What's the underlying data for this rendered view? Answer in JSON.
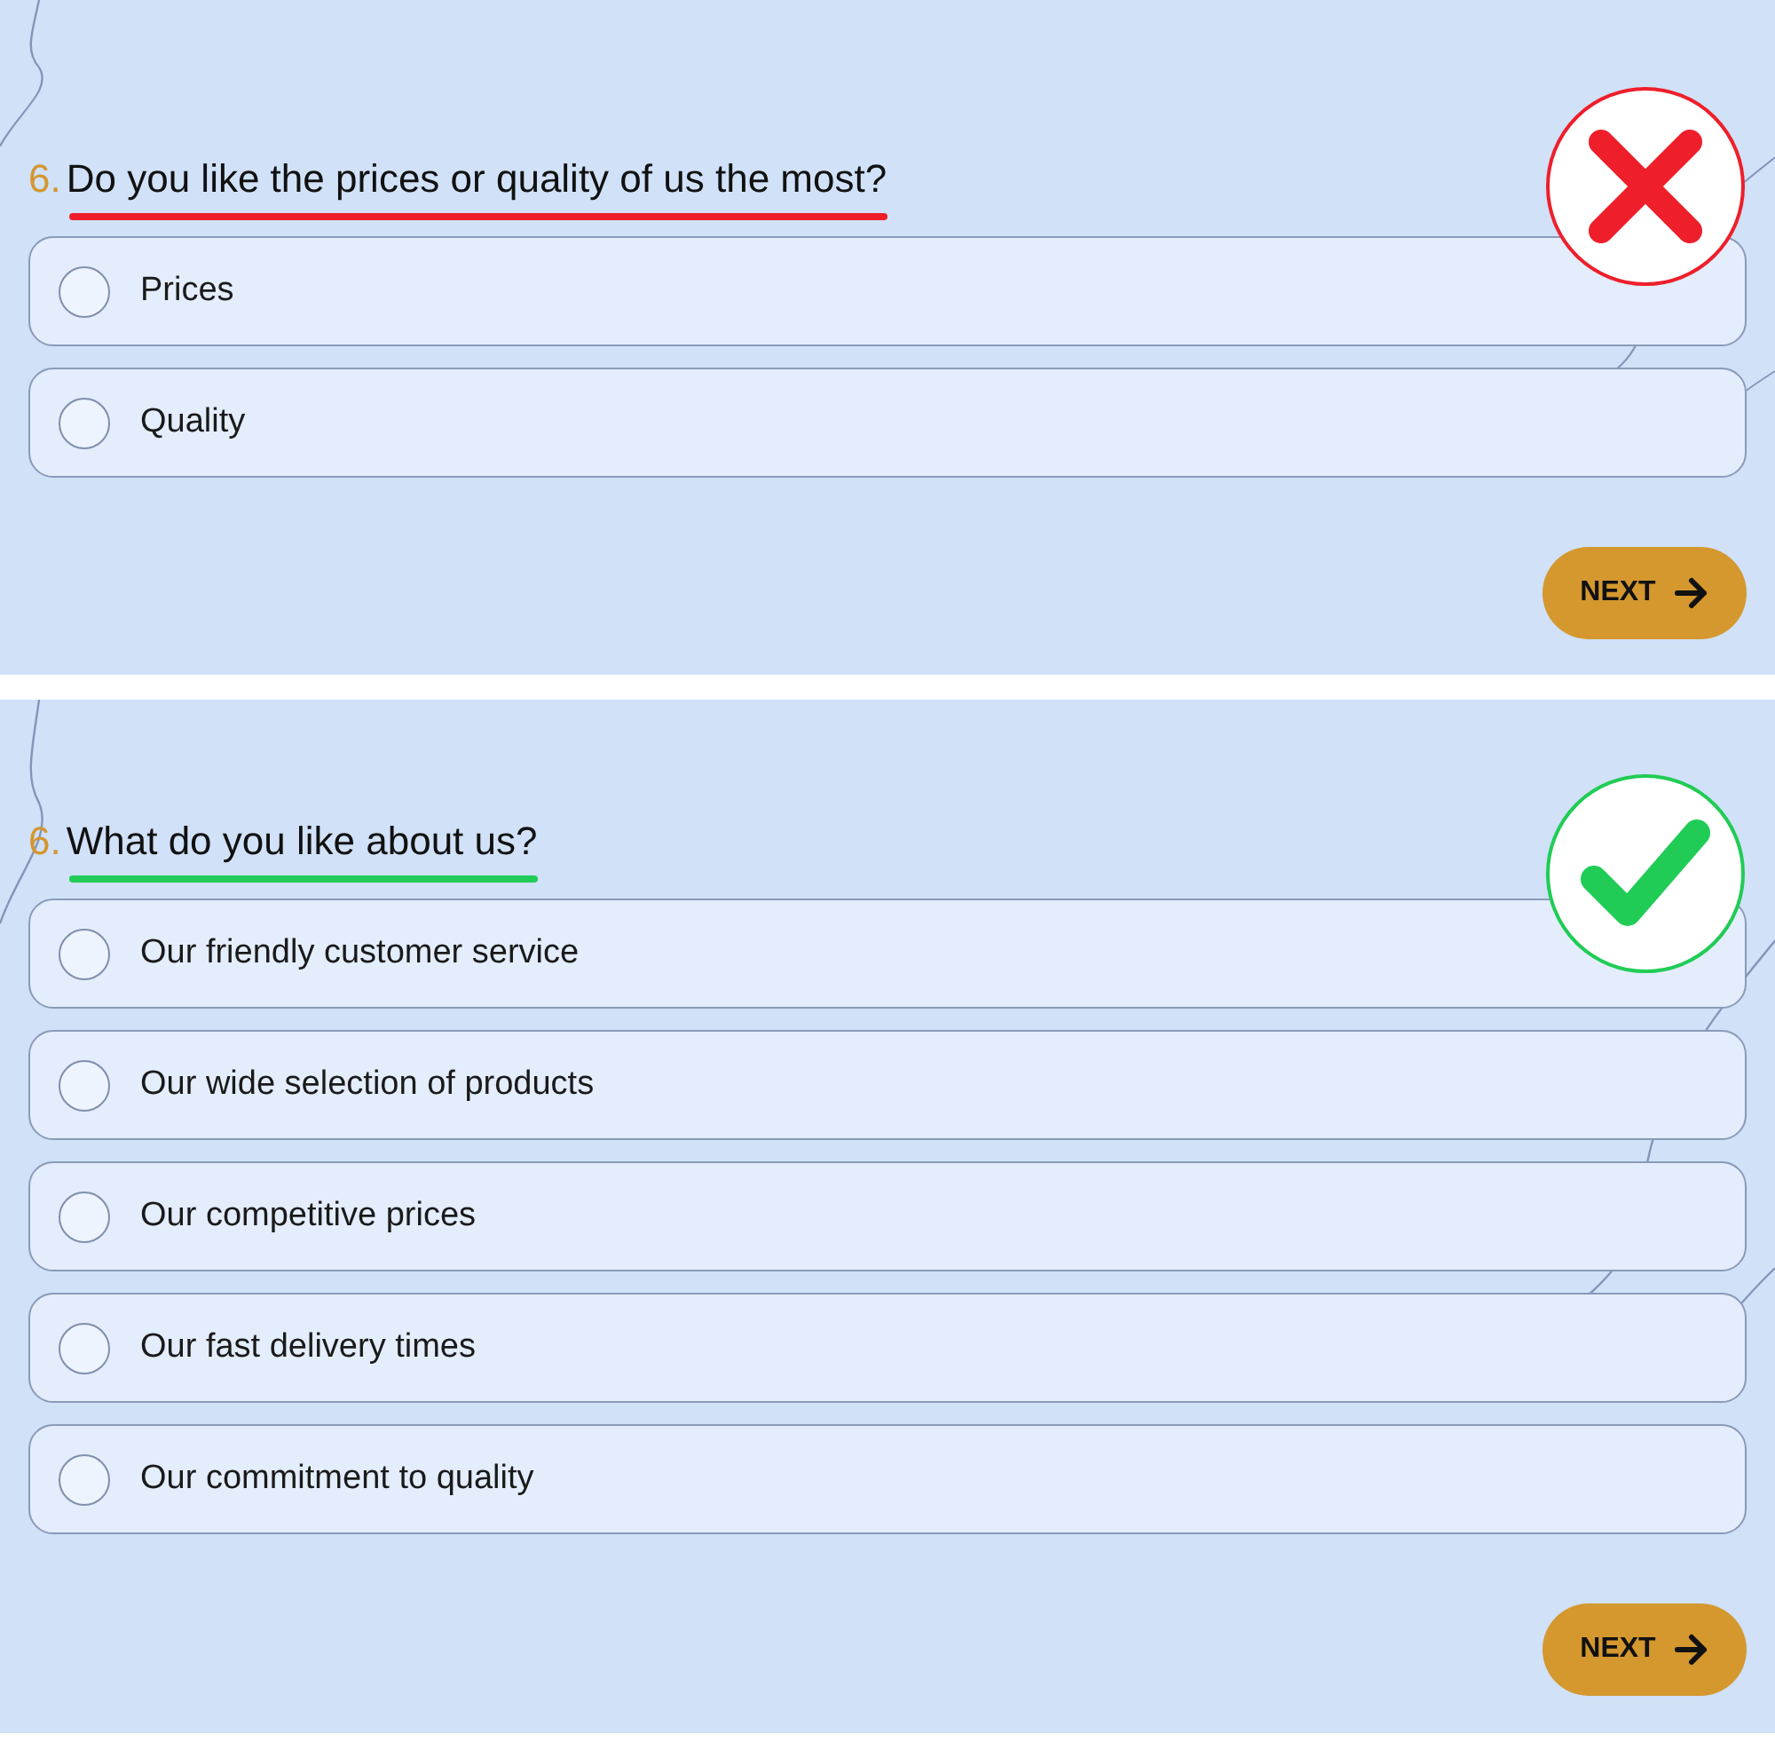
{
  "panels": [
    {
      "correct": false,
      "number": "6.",
      "question": "Do you like the prices or quality of us the most?",
      "options": [
        {
          "label": "Prices",
          "selected": false
        },
        {
          "label": "Quality",
          "selected": false
        }
      ],
      "button": "NEXT"
    },
    {
      "correct": true,
      "number": "6.",
      "question": "What do you like about us?",
      "options": [
        {
          "label": "Our friendly customer service",
          "selected": false
        },
        {
          "label": "Our wide selection of products",
          "selected": false
        },
        {
          "label": "Our competitive prices",
          "selected": false
        },
        {
          "label": "Our fast delivery times",
          "selected": false
        },
        {
          "label": "Our commitment to quality",
          "selected": false
        }
      ],
      "button": "NEXT"
    }
  ]
}
